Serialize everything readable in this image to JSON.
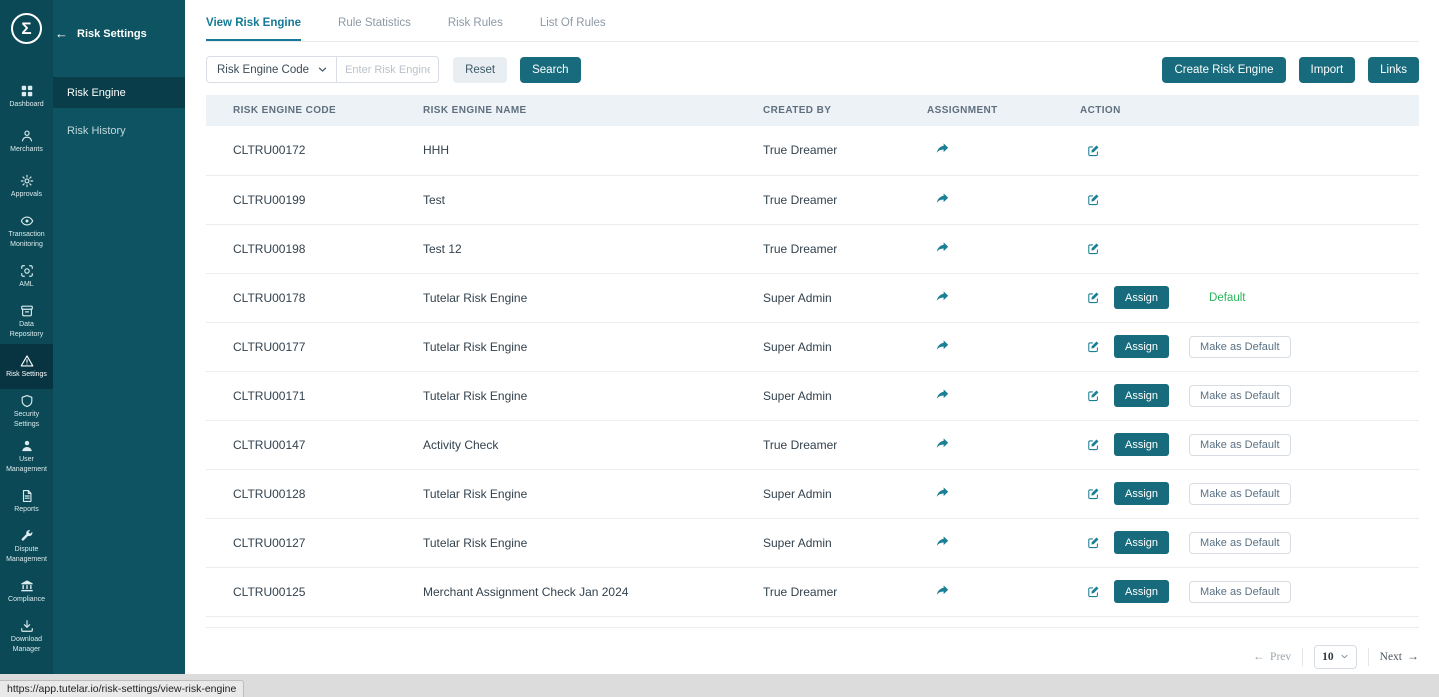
{
  "app": {
    "logo_glyph": "Σ",
    "accent_color": "#176b7c",
    "sidebar_bg": "#0a4955",
    "submenu_bg": "#0d5361",
    "default_green": "#28b75a"
  },
  "sidebar": {
    "items": [
      {
        "label": "Dashboard",
        "icon": "grid-icon",
        "active": false
      },
      {
        "label": "Merchants",
        "icon": "merchant-icon",
        "active": false
      },
      {
        "label": "Approvals",
        "icon": "approvals-icon",
        "active": false
      },
      {
        "label": "Transaction Monitoring",
        "icon": "eye-icon",
        "active": false
      },
      {
        "label": "AML",
        "icon": "aml-scan-icon",
        "active": false
      },
      {
        "label": "Data Repository",
        "icon": "archive-icon",
        "active": false
      },
      {
        "label": "Risk Settings",
        "icon": "warning-triangle-icon",
        "active": true
      },
      {
        "label": "Security Settings",
        "icon": "shield-icon",
        "active": false
      },
      {
        "label": "User Management",
        "icon": "user-icon",
        "active": false
      },
      {
        "label": "Reports",
        "icon": "report-icon",
        "active": false
      },
      {
        "label": "Dispute Management",
        "icon": "wrench-icon",
        "active": false
      },
      {
        "label": "Compliance",
        "icon": "bank-icon",
        "active": false
      },
      {
        "label": "Download Manager",
        "icon": "download-icon",
        "active": false
      }
    ]
  },
  "submenu": {
    "title": "Risk Settings",
    "back_icon": "back-arrow-icon",
    "items": [
      {
        "label": "Risk Engine",
        "active": true
      },
      {
        "label": "Risk History",
        "active": false
      }
    ]
  },
  "tabs": [
    {
      "label": "View Risk Engine",
      "active": true
    },
    {
      "label": "Rule Statistics",
      "active": false
    },
    {
      "label": "Risk Rules",
      "active": false
    },
    {
      "label": "List Of Rules",
      "active": false
    }
  ],
  "filter": {
    "field_selector": "Risk Engine Code",
    "field_selector_icon": "chevron-down-icon",
    "input_placeholder": "Enter Risk Engine Code",
    "input_value": "",
    "reset_label": "Reset",
    "search_label": "Search"
  },
  "header_actions": {
    "create_label": "Create Risk Engine",
    "import_label": "Import",
    "links_label": "Links"
  },
  "table": {
    "headers": [
      "RISK ENGINE CODE",
      "RISK ENGINE NAME",
      "CREATED BY",
      "ASSIGNMENT",
      "ACTION"
    ],
    "assign_label": "Assign",
    "make_default_label": "Make as Default",
    "default_label": "Default",
    "assignment_icon": "share-icon",
    "action_icon": "edit-icon",
    "rows": [
      {
        "code": "CLTRU00172",
        "name": "HHH",
        "created_by": "True Dreamer",
        "has_assign": false,
        "is_default": false
      },
      {
        "code": "CLTRU00199",
        "name": "Test",
        "created_by": "True Dreamer",
        "has_assign": false,
        "is_default": false
      },
      {
        "code": "CLTRU00198",
        "name": "Test 12",
        "created_by": "True Dreamer",
        "has_assign": false,
        "is_default": false
      },
      {
        "code": "CLTRU00178",
        "name": "Tutelar Risk Engine",
        "created_by": "Super Admin",
        "has_assign": true,
        "is_default": true
      },
      {
        "code": "CLTRU00177",
        "name": "Tutelar Risk Engine",
        "created_by": "Super Admin",
        "has_assign": true,
        "is_default": false
      },
      {
        "code": "CLTRU00171",
        "name": "Tutelar Risk Engine",
        "created_by": "Super Admin",
        "has_assign": true,
        "is_default": false
      },
      {
        "code": "CLTRU00147",
        "name": "Activity Check",
        "created_by": "True Dreamer",
        "has_assign": true,
        "is_default": false
      },
      {
        "code": "CLTRU00128",
        "name": "Tutelar Risk Engine",
        "created_by": "Super Admin",
        "has_assign": true,
        "is_default": false
      },
      {
        "code": "CLTRU00127",
        "name": "Tutelar Risk Engine",
        "created_by": "Super Admin",
        "has_assign": true,
        "is_default": false
      },
      {
        "code": "CLTRU00125",
        "name": "Merchant Assignment Check Jan 2024",
        "created_by": "True Dreamer",
        "has_assign": true,
        "is_default": false
      }
    ]
  },
  "pagination": {
    "prev_label": "Prev",
    "page_size": "10",
    "next_label": "Next"
  },
  "statusbar": {
    "url": "https://app.tutelar.io/risk-settings/view-risk-engine"
  }
}
